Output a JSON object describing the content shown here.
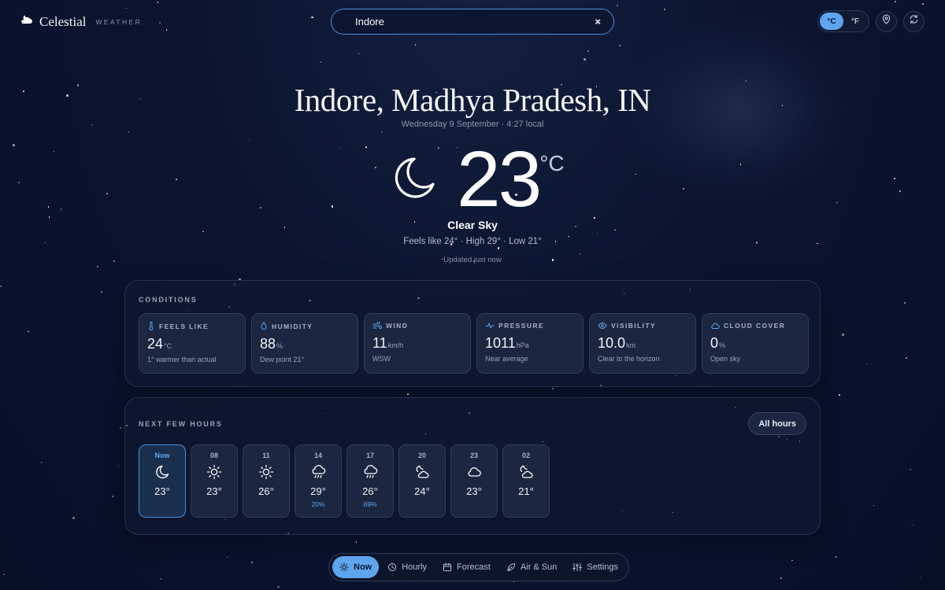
{
  "brand": {
    "name": "Celestial",
    "subtitle": "WEATHER"
  },
  "search": {
    "value": "Indore",
    "clear_label": "×"
  },
  "units": {
    "celsius": "°C",
    "fahrenheit": "°F",
    "active": "celsius"
  },
  "header_icons": [
    "location-pin-icon",
    "refresh-icon"
  ],
  "location": {
    "name": "Indore, Madhya Pradesh, IN",
    "datetime": "Wednesday 9 September · 4:27 local"
  },
  "current": {
    "temp": "23",
    "unit": "°C",
    "icon": "moon-icon",
    "condition": "Clear Sky",
    "summary": "Feels like 24° · High 29° · Low 21°",
    "updated": "Updated just now"
  },
  "conditions": {
    "title": "CONDITIONS",
    "cards": [
      {
        "label": "FEELS LIKE",
        "value": "24",
        "unit": "°C",
        "note": "1° warmer than actual",
        "icon": "thermometer-icon"
      },
      {
        "label": "HUMIDITY",
        "value": "88",
        "unit": "%",
        "note": "Dew point 21°",
        "icon": "droplet-icon"
      },
      {
        "label": "WIND",
        "value": "11",
        "unit": "km/h",
        "note": "WSW",
        "icon": "wind-icon"
      },
      {
        "label": "PRESSURE",
        "value": "1011",
        "unit": "hPa",
        "note": "Near average",
        "icon": "pulse-icon"
      },
      {
        "label": "VISIBILITY",
        "value": "10.0",
        "unit": "km",
        "note": "Clear to the horizon",
        "icon": "eye-icon"
      },
      {
        "label": "CLOUD COVER",
        "value": "0",
        "unit": "%",
        "note": "Open sky",
        "icon": "cloud-icon"
      }
    ]
  },
  "hourly": {
    "title": "NEXT FEW HOURS",
    "all_label": "All hours",
    "items": [
      {
        "time": "Now",
        "icon": "moon",
        "temp": "23°",
        "pop": ""
      },
      {
        "time": "08",
        "icon": "sun",
        "temp": "23°",
        "pop": ""
      },
      {
        "time": "11",
        "icon": "sun",
        "temp": "26°",
        "pop": ""
      },
      {
        "time": "14",
        "icon": "rain",
        "temp": "29°",
        "pop": "20%"
      },
      {
        "time": "17",
        "icon": "rain",
        "temp": "26°",
        "pop": "69%"
      },
      {
        "time": "20",
        "icon": "moon-cloud",
        "temp": "24°",
        "pop": ""
      },
      {
        "time": "23",
        "icon": "cloud",
        "temp": "23°",
        "pop": ""
      },
      {
        "time": "02",
        "icon": "moon-cloud",
        "temp": "21°",
        "pop": ""
      }
    ]
  },
  "nav": [
    {
      "label": "Now",
      "icon": "sun-icon",
      "active": true
    },
    {
      "label": "Hourly",
      "icon": "clock-icon",
      "active": false
    },
    {
      "label": "Forecast",
      "icon": "calendar-icon",
      "active": false
    },
    {
      "label": "Air & Sun",
      "icon": "leaf-icon",
      "active": false
    },
    {
      "label": "Settings",
      "icon": "sliders-icon",
      "active": false
    }
  ],
  "colors": {
    "accent": "#5ea5ee",
    "background": "#0b1530",
    "card": "#1b2640"
  }
}
